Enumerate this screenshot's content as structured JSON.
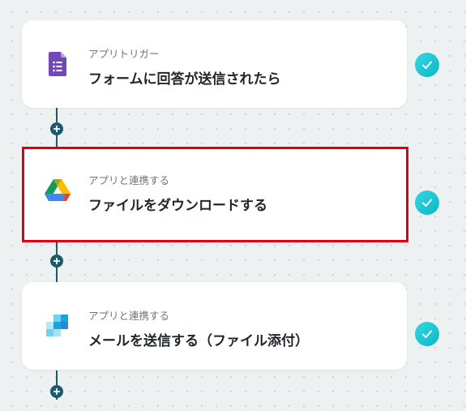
{
  "steps": [
    {
      "subtitle": "アプリトリガー",
      "title": "フォームに回答が送信されたら",
      "icon": "google-forms-icon",
      "status": "complete"
    },
    {
      "subtitle": "アプリと連携する",
      "title": "ファイルをダウンロードする",
      "icon": "google-drive-icon",
      "status": "complete",
      "highlighted": true
    },
    {
      "subtitle": "アプリと連携する",
      "title": "メールを送信する（ファイル添付）",
      "icon": "mail-app-icon",
      "status": "complete"
    }
  ],
  "colors": {
    "background": "#eef1f1",
    "connector": "#1d5a6d",
    "check": "#1fc6d4",
    "highlight_border": "#e0000b",
    "forms_purple": "#7248b9"
  },
  "connector_icon": "plus-icon",
  "status_icon": "checkmark-icon"
}
